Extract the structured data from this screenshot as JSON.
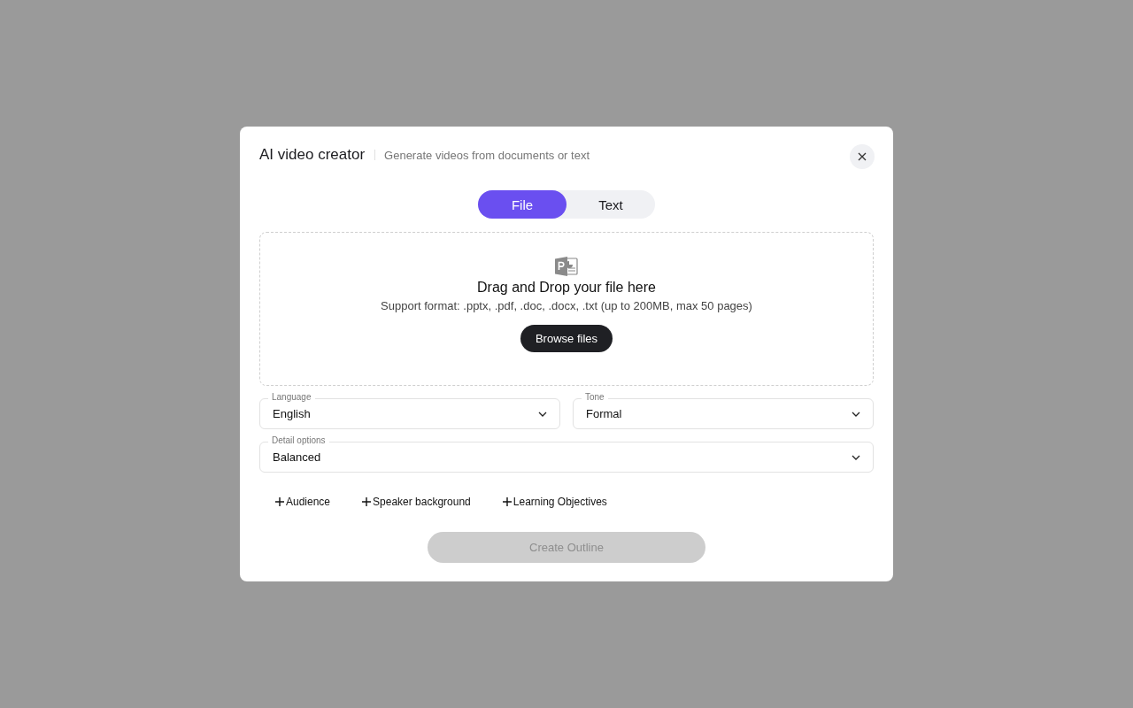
{
  "dialog": {
    "title": "AI video creator",
    "subtitle": "Generate videos from documents or text"
  },
  "tabs": [
    {
      "label": "File",
      "selected": true
    },
    {
      "label": "Text",
      "selected": false
    }
  ],
  "dropzone": {
    "heading": "Drag and Drop your file here",
    "hint": "Support format: .pptx, .pdf, .doc, .docx, .txt (up to 200MB, max 50 pages)",
    "button": "Browse files"
  },
  "selects": [
    {
      "label": "Language",
      "value": "English",
      "wide": false
    },
    {
      "label": "Tone",
      "value": "Formal",
      "wide": false
    },
    {
      "label": "Detail options",
      "value": "Balanced",
      "wide": true
    }
  ],
  "add_buttons": [
    "Audience",
    "Speaker background",
    "Learning Objectives"
  ],
  "submit": {
    "label": "Create Outline",
    "disabled": true
  }
}
